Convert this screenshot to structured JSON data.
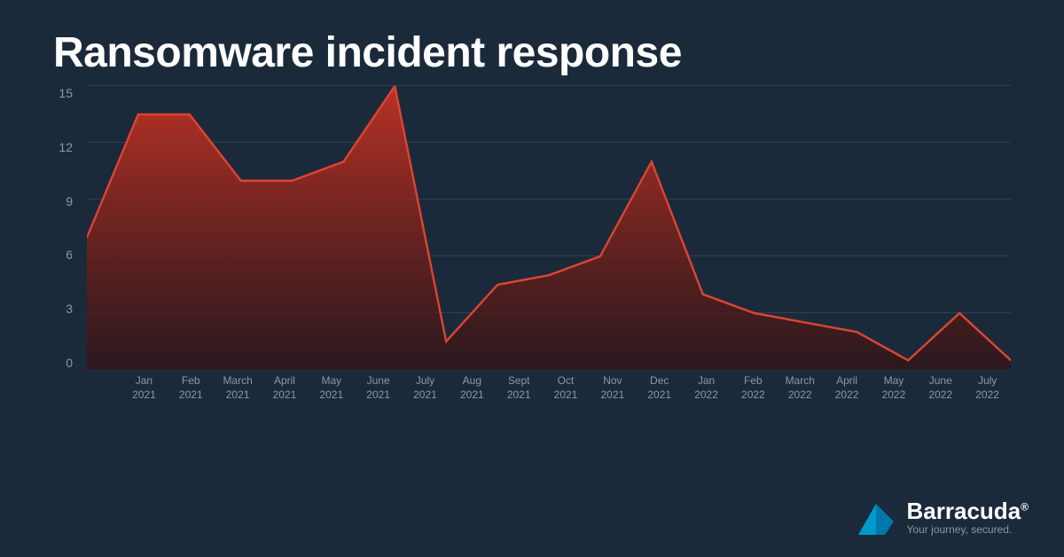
{
  "page": {
    "title": "Ransomware incident response",
    "background_color": "#1a2a3a"
  },
  "chart": {
    "y_axis": {
      "labels": [
        "0",
        "3",
        "6",
        "9",
        "12",
        "15"
      ],
      "max": 15,
      "step": 3
    },
    "x_axis": {
      "labels": [
        {
          "line1": "Jan",
          "line2": "2021"
        },
        {
          "line1": "Feb",
          "line2": "2021"
        },
        {
          "line1": "March",
          "line2": "2021"
        },
        {
          "line1": "April",
          "line2": "2021"
        },
        {
          "line1": "May",
          "line2": "2021"
        },
        {
          "line1": "June",
          "line2": "2021"
        },
        {
          "line1": "July",
          "line2": "2021"
        },
        {
          "line1": "Aug",
          "line2": "2021"
        },
        {
          "line1": "Sept",
          "line2": "2021"
        },
        {
          "line1": "Oct",
          "line2": "2021"
        },
        {
          "line1": "Nov",
          "line2": "2021"
        },
        {
          "line1": "Dec",
          "line2": "2021"
        },
        {
          "line1": "Jan",
          "line2": "2022"
        },
        {
          "line1": "Feb",
          "line2": "2022"
        },
        {
          "line1": "March",
          "line2": "2022"
        },
        {
          "line1": "April",
          "line2": "2022"
        },
        {
          "line1": "May",
          "line2": "2022"
        },
        {
          "line1": "June",
          "line2": "2022"
        },
        {
          "line1": "July",
          "line2": "2022"
        }
      ]
    },
    "data_points": [
      7,
      13.5,
      13.5,
      10,
      10,
      11,
      15,
      1.5,
      4.5,
      5,
      6,
      11,
      4,
      3,
      2.5,
      2,
      0.5,
      3,
      0.5
    ],
    "fill_color_top": "#cc3322",
    "fill_color_bottom": "#441111",
    "line_color": "#dd4433"
  },
  "branding": {
    "company": "Barracuda",
    "registered": "®",
    "tagline": "Your journey, secured."
  }
}
